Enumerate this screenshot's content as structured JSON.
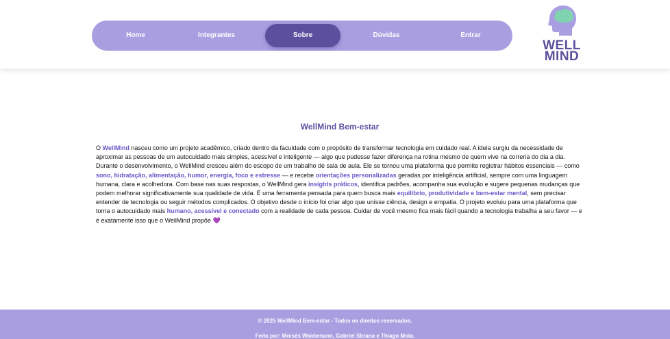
{
  "nav": {
    "items": [
      {
        "label": "Home"
      },
      {
        "label": "Integrantes"
      },
      {
        "label": "Sobre",
        "active": true
      },
      {
        "label": "Dúvidas"
      },
      {
        "label": "Entrar"
      }
    ]
  },
  "logo": {
    "line1": "WELL",
    "line2": "MIND",
    "icon": "head-brain-icon",
    "colors": {
      "head": "#a99ee0",
      "brain": "#7fd3b0",
      "text": "#5b4f9e"
    }
  },
  "main": {
    "title": "WellMind Bem-estar",
    "paragraph": [
      {
        "t": "O "
      },
      {
        "t": "WellMind",
        "hl": true
      },
      {
        "t": " nasceu como um projeto acadêmico, criado dentro da faculdade com o propósito de transformar tecnologia em cuidado real. A ideia surgiu da necessidade de aproximar as pessoas de um autocuidado mais simples, acessível e inteligente — algo que pudesse fazer diferença na rotina mesmo de quem vive na correria do dia a dia. Durante o desenvolvimento, o WellMind cresceu além do escopo de um trabalho de sala de aula. Ele se tornou uma plataforma que permite registrar hábitos essenciais — como "
      },
      {
        "t": "sono, hidratação, alimentação, humor, energia, foco e estresse",
        "hl": true
      },
      {
        "t": " — e recebe "
      },
      {
        "t": "orientações personalizadas",
        "hl": true
      },
      {
        "t": " geradas por inteligência artificial, sempre com uma linguagem humana, clara e acolhedora. Com base nas suas respostas, o WellMind gera "
      },
      {
        "t": "insights práticos",
        "hl": true
      },
      {
        "t": ", identifica padrões, acompanha sua evolução e sugere pequenas mudanças que podem melhorar significativamente sua qualidade de vida. É uma ferramenta pensada para quem busca mais "
      },
      {
        "t": "equilíbrio, produtividade e bem-estar mental",
        "hl": true
      },
      {
        "t": ", sem precisar entender de tecnologia ou seguir métodos complicados. O objetivo desde o início foi criar algo que unisse ciência, design e empatia. O projeto evoluiu para uma plataforma que torna o autocuidado mais "
      },
      {
        "t": "humano, acessível e conectado",
        "hl": true
      },
      {
        "t": " com a realidade de cada pessoa. Cuidar de você mesmo fica mais fácil quando a tecnologia trabalha a seu favor — e é exatamente isso que o WellMind propõe "
      },
      {
        "t": "💜",
        "heart": true
      }
    ]
  },
  "footer": {
    "copyright": "© 2025 WellMind Bem-estar - Todos os direitos reservados.",
    "credits": "Feito por: Moisés Waidemann, Gabriel Sbrana e Thiago Mota."
  },
  "colors": {
    "accent": "#a99ee0",
    "accent_dark": "#5b4f9e",
    "highlight": "#6a55c7"
  }
}
